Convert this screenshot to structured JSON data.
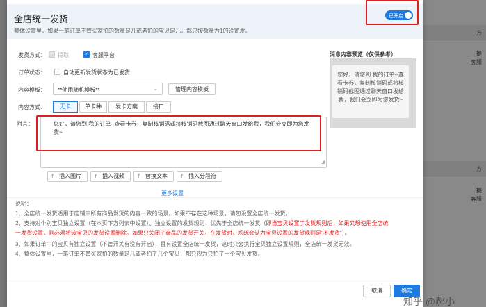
{
  "background": {
    "right_headers": [
      "方",
      "方"
    ],
    "right_row1": [
      "提",
      "客服"
    ],
    "right_row2": [
      "提",
      "客服"
    ]
  },
  "modal": {
    "title": "全店统一发货",
    "subtitle": "整体设置里，如果一笔订单不管买家拍的数量是几或者拍的宝贝是几，都只按数量为1的设置发。",
    "switch_label": "已开启",
    "ship_method": {
      "label": "发货方式：",
      "options": [
        {
          "label": "提取",
          "checked": true,
          "disabled": true
        },
        {
          "label": "客服平台",
          "checked": true,
          "disabled": false
        }
      ]
    },
    "order_status": {
      "label": "订单状态：",
      "checkbox_label": "自动更新发货状态为已发货"
    },
    "template": {
      "label": "内容模板：",
      "selected": "**使用随机模板**",
      "manage_button": "管理内容模板"
    },
    "content_method": {
      "label": "内容方式：",
      "tabs": [
        "无卡",
        "单卡种",
        "发卡方案",
        "接口"
      ],
      "active_tab": "无卡"
    },
    "note": {
      "label": "附言：",
      "text": "您好，请您到 我的订单--查看卡券，复制核销码或将核销码截图通过聊天窗口发给我，我们会立即为您发货~"
    },
    "insert_buttons": [
      "插入图片",
      "插入视频",
      "替换文本",
      "插入分段符"
    ],
    "more_settings": "更多设置",
    "preview": {
      "title": "消息内容预览（仅供参考）",
      "text": "您好，请您到 我的订单--查看卡券，复制核销码或将核销码截图通过聊天窗口发给我，我们会立即为您发货~"
    },
    "instructions": {
      "heading": "说明：",
      "line1": "1、全店统一发货适用于店铺中所有商品发货的内容一致的场景。如果不存在这种场景，请勿设置全店统一发货。",
      "line2a": "2、支持对个别宝贝独立设置（在本页下方列表中设置）。独立设置的发货规则，优先于全店统一发货（",
      "line2b": "即当宝贝设置了发货规则后，如果又想使用全店统",
      "line2c": "一发货设置，则必须将该宝贝的发货设置删除。如果只关闭了商品的发货开关，在发货时，系统会认为宝贝设置的发货规则是\"不发货\"",
      "line2d": "）。",
      "line3": "3、如果订单中的宝贝有独立设置（不管开关有没有开启），且有设置全店统一发货，这时只会执行宝贝独立设置规则，全店统一发货无效。",
      "line4": "4、整体设置里，一笔订单不管买家拍的数量是几或者拍了几个宝贝，都只视为只拍了一个宝贝发货。"
    },
    "footer": {
      "cancel": "取消",
      "ok": "确定"
    }
  },
  "watermark": "知乎 @郝小"
}
